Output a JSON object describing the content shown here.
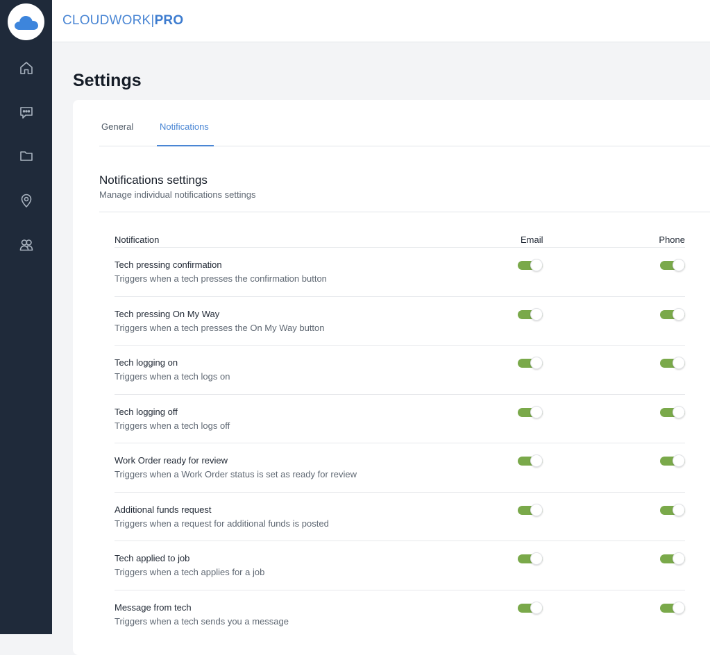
{
  "brand": {
    "name": "CLOUDWORK",
    "separator": "|",
    "suffix": "PRO"
  },
  "nav": {
    "items": [
      {
        "icon": "home-icon"
      },
      {
        "icon": "chat-icon"
      },
      {
        "icon": "folder-icon"
      },
      {
        "icon": "location-pin-icon"
      },
      {
        "icon": "users-icon"
      }
    ]
  },
  "page": {
    "title": "Settings"
  },
  "tabs": [
    {
      "label": "General",
      "active": false
    },
    {
      "label": "Notifications",
      "active": true
    }
  ],
  "section": {
    "title": "Notifications settings",
    "subtitle": "Manage individual notifications settings"
  },
  "table": {
    "headers": {
      "notification": "Notification",
      "email": "Email",
      "phone": "Phone"
    },
    "rows": [
      {
        "name": "Tech pressing confirmation",
        "desc": "Triggers when a tech presses the confirmation button",
        "email": true,
        "phone": true
      },
      {
        "name": "Tech pressing On My Way",
        "desc": "Triggers when a tech presses the On My Way button",
        "email": true,
        "phone": true
      },
      {
        "name": "Tech logging on",
        "desc": "Triggers when a tech logs on",
        "email": true,
        "phone": true
      },
      {
        "name": "Tech logging off",
        "desc": "Triggers when a tech logs off",
        "email": true,
        "phone": true
      },
      {
        "name": "Work Order ready for review",
        "desc": "Triggers when a Work Order status is set as ready for review",
        "email": true,
        "phone": true
      },
      {
        "name": "Additional funds request",
        "desc": "Triggers when a request for additional funds is posted",
        "email": true,
        "phone": true
      },
      {
        "name": "Tech applied to job",
        "desc": "Triggers when a tech applies for a job",
        "email": true,
        "phone": true
      },
      {
        "name": "Message from tech",
        "desc": "Triggers when a tech sends you a message",
        "email": true,
        "phone": true
      }
    ]
  },
  "colors": {
    "accent": "#4a86d4",
    "toggle_on": "#7aa94a",
    "sidebar": "#1f2a3a"
  }
}
